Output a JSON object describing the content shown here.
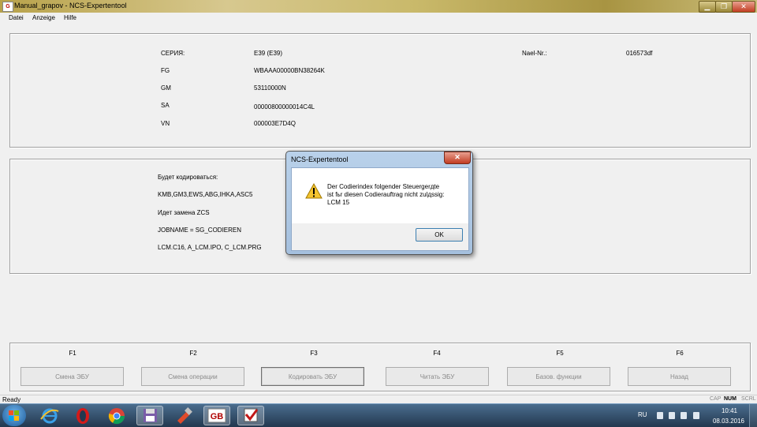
{
  "window": {
    "title": "Manual_grapov - NCS-Expertentool",
    "icon_label": "G"
  },
  "menu": {
    "items": [
      "Datei",
      "Anzeige",
      "Hilfe"
    ]
  },
  "vehicle_info": {
    "series_label": "СЕРИЯ:",
    "series_value": "E39 (E39)",
    "fg_label": "FG",
    "fg_value": "WBAAA00000BN38264K",
    "gm_label": "GM",
    "gm_value": "53110000N",
    "sa_label": "SA",
    "sa_value": "00000800000014C4L",
    "vn_label": "VN",
    "vn_value": "000003E7D4Q",
    "nael_label": "Nael-Nr.:",
    "nael_value": "016573df"
  },
  "coding_info": {
    "line1": "Будет кодироваться:",
    "line2": "KMB,GM3,EWS,ABG,IHKA,ASC5",
    "line3": "Идет замена ZCS",
    "line4": "JOBNAME = SG_CODIEREN",
    "line5": "LCM.C16, A_LCM.IPO, C_LCM.PRG"
  },
  "function_keys": [
    {
      "key": "F1",
      "label": "Смена ЭБУ"
    },
    {
      "key": "F2",
      "label": "Смена операции"
    },
    {
      "key": "F3",
      "label": "Кодировать ЭБУ"
    },
    {
      "key": "F4",
      "label": "Читать ЭБУ"
    },
    {
      "key": "F5",
      "label": "Базов. функции"
    },
    {
      "key": "F6",
      "label": "Назад"
    }
  ],
  "status": {
    "text": "Ready",
    "cap": "CAP",
    "num": "NUM",
    "scrl": "SCRL"
  },
  "dialog": {
    "title": "NCS-Expertentool",
    "message": "Der Codierindex folgender Steuergerдte\nist fьr diesen Codierauftrag nicht zulдssig:\nLCM 15",
    "ok": "OK"
  },
  "taskbar": {
    "apps": [
      "internet-explorer",
      "opera",
      "chrome",
      "floppy-save",
      "toolbox",
      "ncs-expert",
      "checkbox-app"
    ],
    "language": "RU",
    "time": "10:41",
    "date": "08.03.2016"
  },
  "colors": {
    "titlebar": "#c9b96a",
    "taskbar": "#2f4a66",
    "dialog_frame": "#b9d1ea"
  }
}
